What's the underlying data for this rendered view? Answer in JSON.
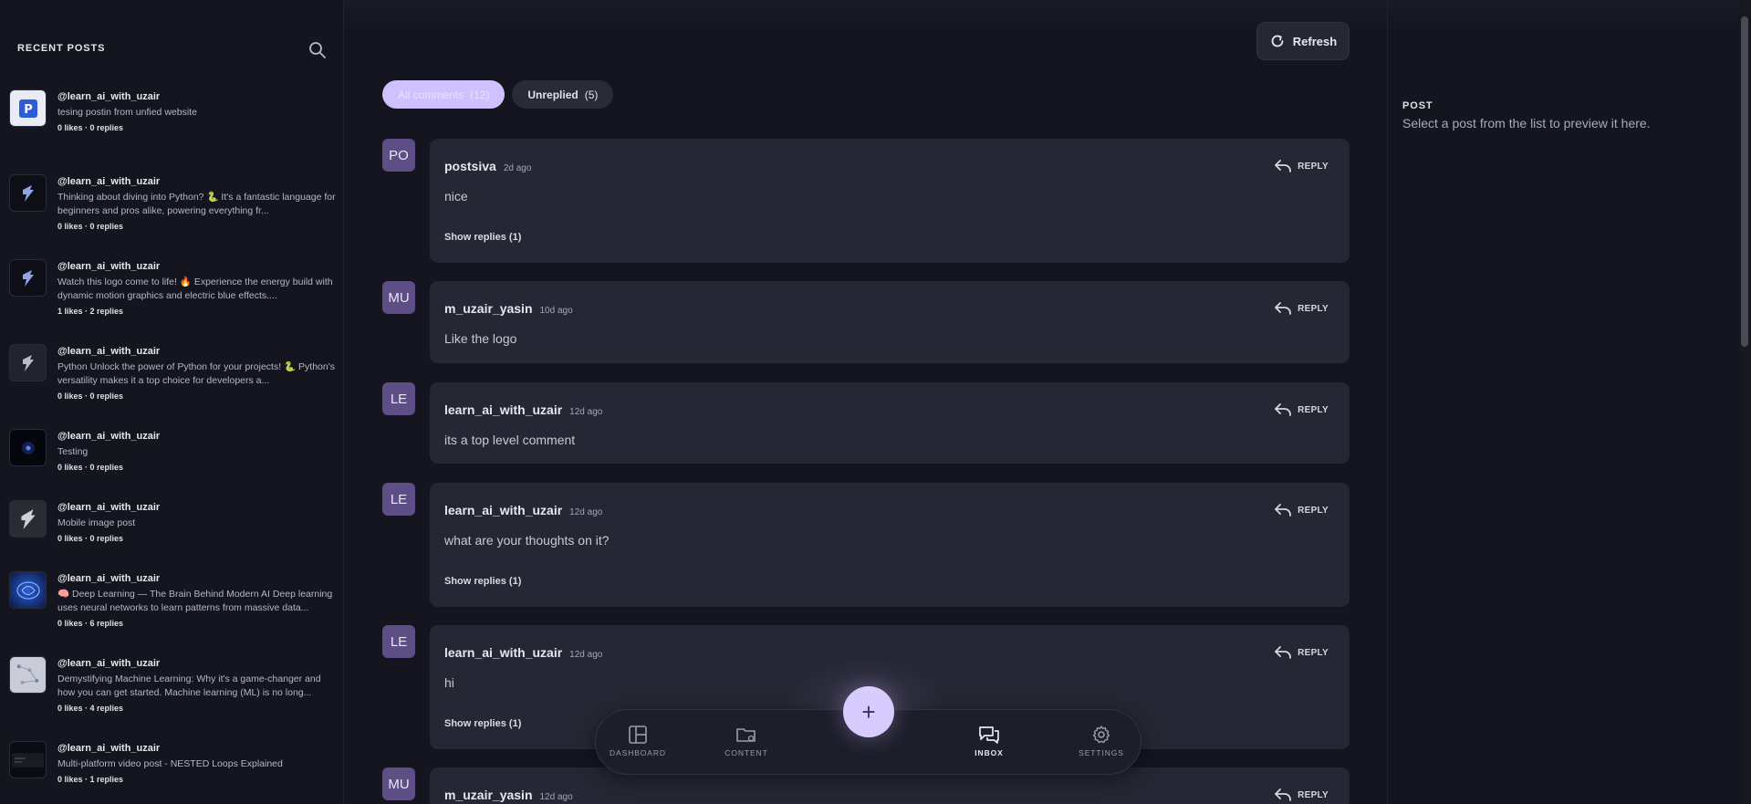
{
  "sidebar": {
    "title": "RECENT POSTS",
    "search_icon": "search-icon",
    "posts": [
      {
        "user": "@learn_ai_with_uzair",
        "text": "tesing postin from unfied website",
        "meta": "0 likes · 0 replies",
        "thumb": "postiva-logo"
      },
      {
        "user": "@learn_ai_with_uzair",
        "text": "Thinking about diving into Python? 🐍 It's a fantastic language for beginners and pros alike, powering everything fr...",
        "meta": "0 likes · 0 replies",
        "thumb": "bolt-logo"
      },
      {
        "user": "@learn_ai_with_uzair",
        "text": "Watch this logo come to life! 🔥 Experience the energy build with dynamic motion graphics and electric blue effects....",
        "meta": "1 likes · 2 replies",
        "thumb": "bolt-logo"
      },
      {
        "user": "@learn_ai_with_uzair",
        "text": "Python Unlock the power of Python for your projects! 🐍 Python's versatility makes it a top choice for developers a...",
        "meta": "0 likes · 0 replies",
        "thumb": "bolt-logo-dark"
      },
      {
        "user": "@learn_ai_with_uzair",
        "text": "Testing",
        "meta": "0 likes · 0 replies",
        "thumb": "glow-dot"
      },
      {
        "user": "@learn_ai_with_uzair",
        "text": "Mobile image post",
        "meta": "0 likes · 0 replies",
        "thumb": "bolt-logo-grey"
      },
      {
        "user": "@learn_ai_with_uzair",
        "text": "🧠 Deep Learning — The Brain Behind Modern AI Deep learning uses neural networks to learn patterns from massive data...",
        "meta": "0 likes · 6 replies",
        "thumb": "neural-brain"
      },
      {
        "user": "@learn_ai_with_uzair",
        "text": "Demystifying Machine Learning: Why it's a game-changer and how you can get started. Machine learning (ML) is no long...",
        "meta": "0 likes · 4 replies",
        "thumb": "ml-pattern"
      },
      {
        "user": "@learn_ai_with_uzair",
        "text": "Multi-platform video post - NESTED Loops Explained",
        "meta": "0 likes · 1 replies",
        "thumb": "video-frame"
      }
    ]
  },
  "main": {
    "refresh_label": "Refresh",
    "tabs": [
      {
        "label": "All comments",
        "count": "(12)"
      },
      {
        "label": "Unreplied",
        "count": "(5)"
      }
    ],
    "reply_label": "REPLY",
    "comments": [
      {
        "initials": "PO",
        "author": "postsiva",
        "time": "2d ago",
        "text": "nice",
        "show_replies": "Show replies (1)"
      },
      {
        "initials": "MU",
        "author": "m_uzair_yasin",
        "time": "10d ago",
        "text": "Like the logo",
        "show_replies": ""
      },
      {
        "initials": "LE",
        "author": "learn_ai_with_uzair",
        "time": "12d ago",
        "text": "its a top level comment",
        "show_replies": ""
      },
      {
        "initials": "LE",
        "author": "learn_ai_with_uzair",
        "time": "12d ago",
        "text": "what are your thoughts on it?",
        "show_replies": "Show replies (1)"
      },
      {
        "initials": "LE",
        "author": "learn_ai_with_uzair",
        "time": "12d ago",
        "text": "hi",
        "show_replies": "Show replies (1)"
      },
      {
        "initials": "MU",
        "author": "m_uzair_yasin",
        "time": "12d ago",
        "text": "",
        "show_replies": ""
      }
    ]
  },
  "preview": {
    "label": "POST",
    "text": "Select a post from the list to preview it here."
  },
  "nav": {
    "items": [
      {
        "label": "DASHBOARD",
        "icon": "dashboard-icon"
      },
      {
        "label": "CONTENT",
        "icon": "content-folder-icon"
      },
      {
        "label": "INBOX",
        "icon": "inbox-icon"
      },
      {
        "label": "SETTINGS",
        "icon": "gear-icon"
      }
    ],
    "fab_label": "+",
    "active": "INBOX"
  },
  "colors": {
    "background": "#14151f",
    "card": "#262734",
    "accent": "#cfc0ff",
    "avatar": "#5d4e86"
  }
}
